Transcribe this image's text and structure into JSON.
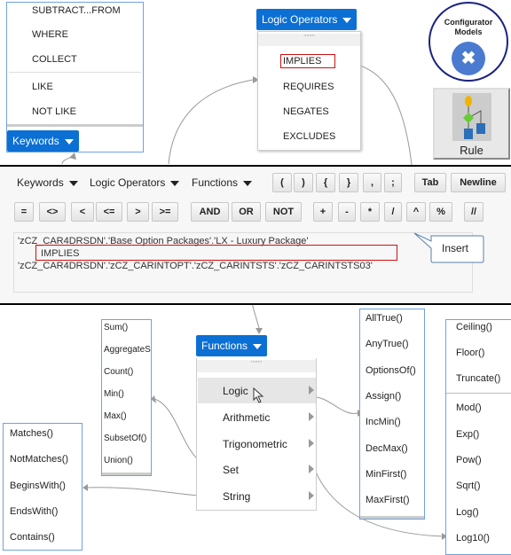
{
  "keywords_menu": {
    "items": [
      "SUBTRACT...FROM",
      "WHERE",
      "COLLECT",
      "LIKE",
      "NOT LIKE"
    ],
    "button": "Keywords"
  },
  "logic_menu": {
    "button": "Logic Operators",
    "items": [
      "IMPLIES",
      "REQUIRES",
      "NEGATES",
      "EXCLUDES"
    ]
  },
  "configurator": {
    "line1": "Configurator",
    "line2": "Models"
  },
  "rule_button": {
    "label": "Rule"
  },
  "toolbar": {
    "dropdowns": [
      "Keywords",
      "Logic Operators",
      "Functions"
    ],
    "row1_buttons": [
      "(",
      ")",
      "{",
      "}",
      ",",
      ";",
      "Tab",
      "Newline"
    ],
    "row2_buttons": [
      "=",
      "<>",
      "<",
      "<=",
      ">",
      ">=",
      "AND",
      "OR",
      "NOT",
      "+",
      "-",
      "*",
      "/",
      "^",
      "%",
      "//"
    ]
  },
  "editor": {
    "line1": "'zCZ_CAR4DRSDN'.'Base Option Packages'.'LX - Luxury Package'",
    "line2": "IMPLIES",
    "line3": "'zCZ_CAR4DRSDN'.'zCZ_CARINTOPT'.'zCZ_CARINTSTS'.'zCZ_CARINTSTS03'"
  },
  "callout": {
    "label": "Insert"
  },
  "functions_menu": {
    "button": "Functions",
    "items": [
      "Logic",
      "Arithmetic",
      "Trigonometric",
      "Set",
      "String"
    ]
  },
  "set_menu": {
    "items": [
      "Sum()",
      "AggregateS",
      "Count()",
      "Min()",
      "Max()",
      "SubsetOf()",
      "Union()"
    ]
  },
  "string_menu": {
    "items": [
      "Matches()",
      "NotMatches()",
      "BeginsWith()",
      "EndsWith()",
      "Contains()"
    ]
  },
  "logic_fn_menu": {
    "items": [
      "AllTrue()",
      "AnyTrue()",
      "OptionsOf()",
      "Assign()",
      "IncMin()",
      "DecMax()",
      "MinFirst()",
      "MaxFirst()"
    ]
  },
  "arith_menu": {
    "items": [
      "Ceiling()",
      "Floor()",
      "Truncate()",
      "Mod()",
      "Exp()",
      "Pow()",
      "Sqrt()",
      "Log()",
      "Log10()"
    ]
  },
  "colors": {
    "accent": "#0b6fd4",
    "highlight_box": "#d01010",
    "connector": "#999999"
  }
}
